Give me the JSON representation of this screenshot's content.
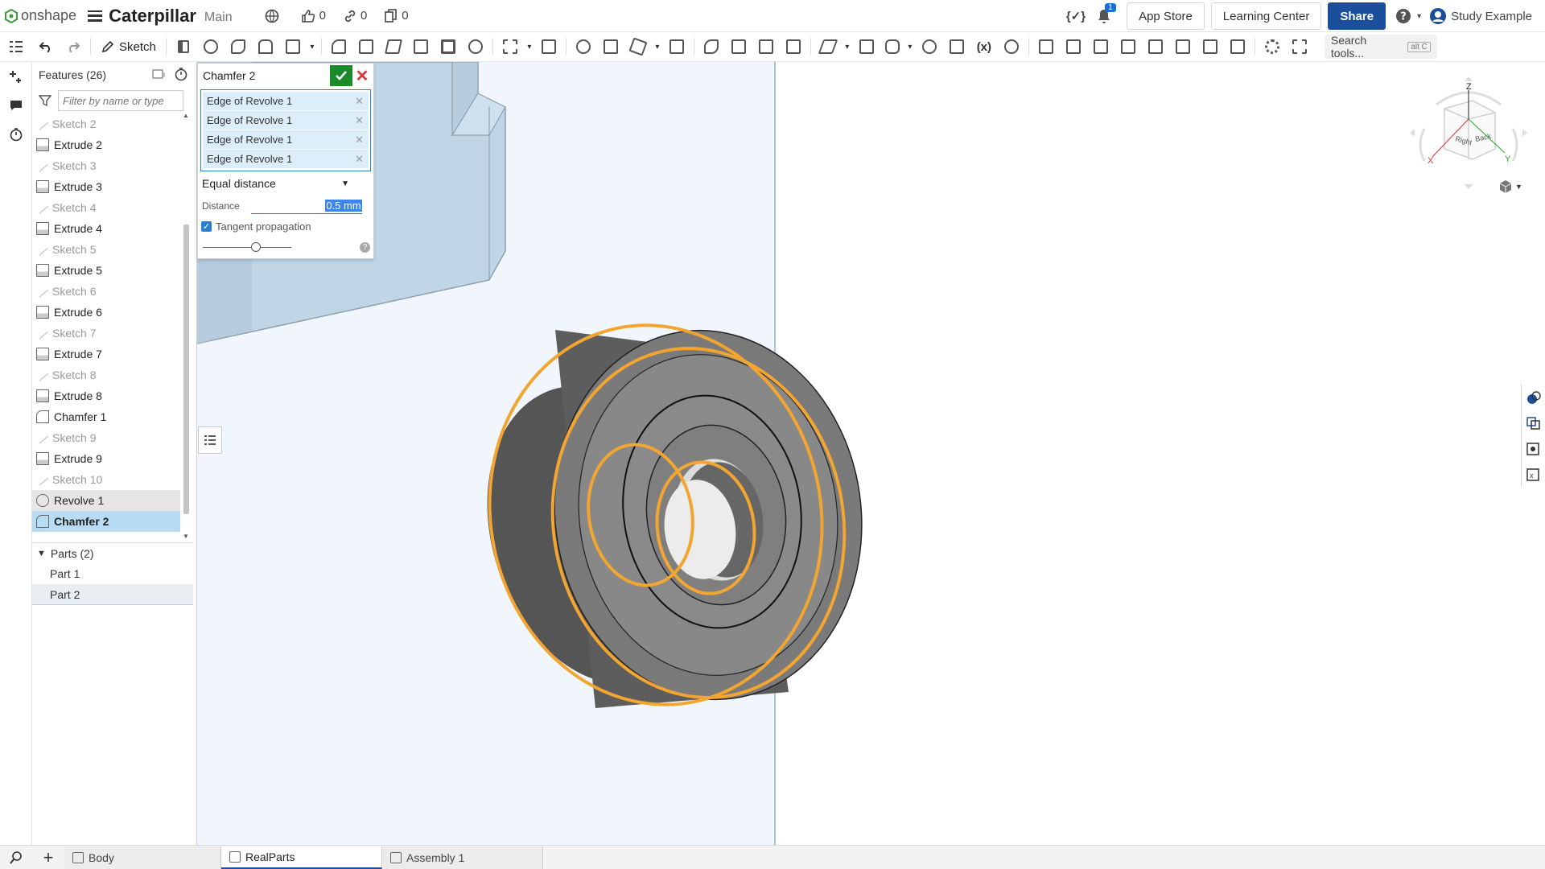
{
  "app": {
    "name": "onshape",
    "document_title": "Caterpillar",
    "branch": "Main"
  },
  "top": {
    "likes": "0",
    "links": "0",
    "copies": "0",
    "notifications": "1"
  },
  "top_buttons": {
    "app_store": "App Store",
    "learning_center": "Learning Center",
    "share": "Share",
    "user": "Study Example"
  },
  "toolbar": {
    "sketch_label": "Sketch",
    "search_label": "Search tools...",
    "search_shortcut": "alt C",
    "variable": "(x)"
  },
  "tree": {
    "title": "Features (26)",
    "filter_placeholder": "Filter by name or type",
    "features": [
      {
        "label": "Sketch 2",
        "type": "sketch"
      },
      {
        "label": "Extrude 2",
        "type": "extrude"
      },
      {
        "label": "Sketch 3",
        "type": "sketch"
      },
      {
        "label": "Extrude 3",
        "type": "extrude"
      },
      {
        "label": "Sketch 4",
        "type": "sketch"
      },
      {
        "label": "Extrude 4",
        "type": "extrude"
      },
      {
        "label": "Sketch 5",
        "type": "sketch"
      },
      {
        "label": "Extrude 5",
        "type": "extrude"
      },
      {
        "label": "Sketch 6",
        "type": "sketch"
      },
      {
        "label": "Extrude 6",
        "type": "extrude"
      },
      {
        "label": "Sketch 7",
        "type": "sketch"
      },
      {
        "label": "Extrude 7",
        "type": "extrude"
      },
      {
        "label": "Sketch 8",
        "type": "sketch"
      },
      {
        "label": "Extrude 8",
        "type": "extrude"
      },
      {
        "label": "Chamfer 1",
        "type": "chamfer"
      },
      {
        "label": "Sketch 9",
        "type": "sketch"
      },
      {
        "label": "Extrude 9",
        "type": "extrude"
      },
      {
        "label": "Sketch 10",
        "type": "sketch"
      },
      {
        "label": "Revolve 1",
        "type": "revolve"
      },
      {
        "label": "Chamfer 2",
        "type": "chamfer"
      }
    ],
    "parts_header": "Parts (2)",
    "parts": [
      "Part 1",
      "Part 2"
    ]
  },
  "dialog": {
    "title": "Chamfer 2",
    "edges": [
      "Edge of Revolve 1",
      "Edge of Revolve 1",
      "Edge of Revolve 1",
      "Edge of Revolve 1"
    ],
    "mode": "Equal distance",
    "distance_label": "Distance",
    "distance_value": "0.5 mm",
    "tangent_label": "Tangent propagation",
    "tangent_checked": true,
    "slider_fraction": 0.6
  },
  "viewcube": {
    "z": "Z",
    "x": "X",
    "y": "Y",
    "right": "Right",
    "back": "Back"
  },
  "tabs": [
    {
      "label": "Body",
      "active": false
    },
    {
      "label": "RealParts",
      "active": true
    },
    {
      "label": "Assembly 1",
      "active": false
    }
  ],
  "colors": {
    "selection": "#f2a531",
    "accent": "#1b4f9c",
    "selected_row": "#b7dcf4",
    "part": "#8a8a8a",
    "plate": "#96b8d2"
  }
}
